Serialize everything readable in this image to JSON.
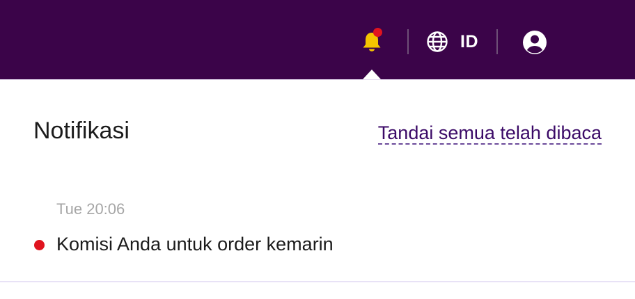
{
  "topbar": {
    "background": "#3b0449",
    "notifications": {
      "icon": "bell-icon",
      "color": "#f5c400",
      "has_unread": true
    },
    "language": {
      "icon": "globe-icon",
      "label": "ID"
    },
    "account": {
      "icon": "user-circle-icon"
    }
  },
  "panel": {
    "title": "Notifikasi",
    "mark_all_read": "Tandai semua telah dibaca",
    "items": [
      {
        "time": "Tue 20:06",
        "text": "Komisi Anda untuk order kemarin",
        "unread": true
      }
    ]
  },
  "colors": {
    "accent": "#3b0449",
    "unread": "#e0141f",
    "link": "#3b0a67"
  }
}
